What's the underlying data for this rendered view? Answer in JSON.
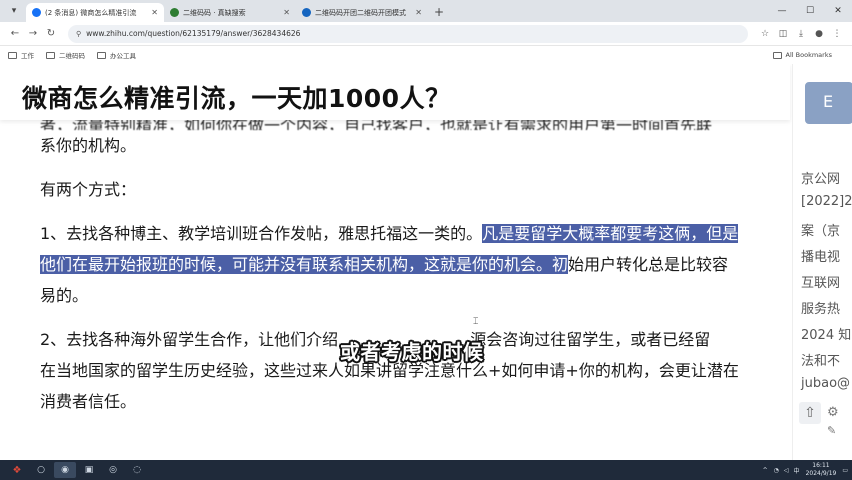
{
  "browser": {
    "tabs": [
      {
        "title": "(2 条消息) 微商怎么精准引流",
        "active": true,
        "favicon_color": "#1772f6"
      },
      {
        "title": "二维码码 · 真缺搜索",
        "active": false,
        "favicon_color": "#2e7d32"
      },
      {
        "title": "二维码码开团二维码开团模式",
        "active": false,
        "favicon_color": "#1565c0"
      }
    ],
    "address": "www.zhihu.com/question/62135179/answer/3628434626",
    "bookmarks": [
      "工作",
      "二维码码",
      "办公工具"
    ],
    "all_bookmarks": "All Bookmarks"
  },
  "question": {
    "title": "微商怎么精准引流，一天加1000人？"
  },
  "article": {
    "cut_line": "者，流量特别精准，如何你在做一个内容，自己找客户，也就是让有需求的用户第一时间首先联",
    "p1_rest": "系你的机构。",
    "p2": "有两个方式：",
    "p3_a": "1、去找各种博主、教学培训班合作发帖，雅思托福这一类的。",
    "p3_hl1": "凡是要留学大概率都要考这俩，但是",
    "p3_hl2": "他们在最开始报班的时候，可能并没有联系相关机构，这就是你的机会。初",
    "p3_b": "始用户转化总是比较容",
    "p3_c": "易的。",
    "p4_a": "2、去找各种海外留学生合作，让他们介绍",
    "p4_b": "源会咨询过往留学生，或者已经留",
    "p4_c": "在当地国家的留学生历史经验，这些过来人如果讲留学注意什么+如何申请+你的机构，会更让潜在",
    "p4_d": "消费者信任。"
  },
  "subtitle": "或者考虑的时候",
  "rail": {
    "button_text": "E",
    "lines": [
      "京公网",
      "[2022]2",
      "案（京",
      "播电视",
      "互联网",
      "服务热",
      "2024 知",
      "法和不",
      "jubao@"
    ]
  },
  "taskbar": {
    "time": "16:11",
    "date": "2024/9/19",
    "lang": "中"
  }
}
